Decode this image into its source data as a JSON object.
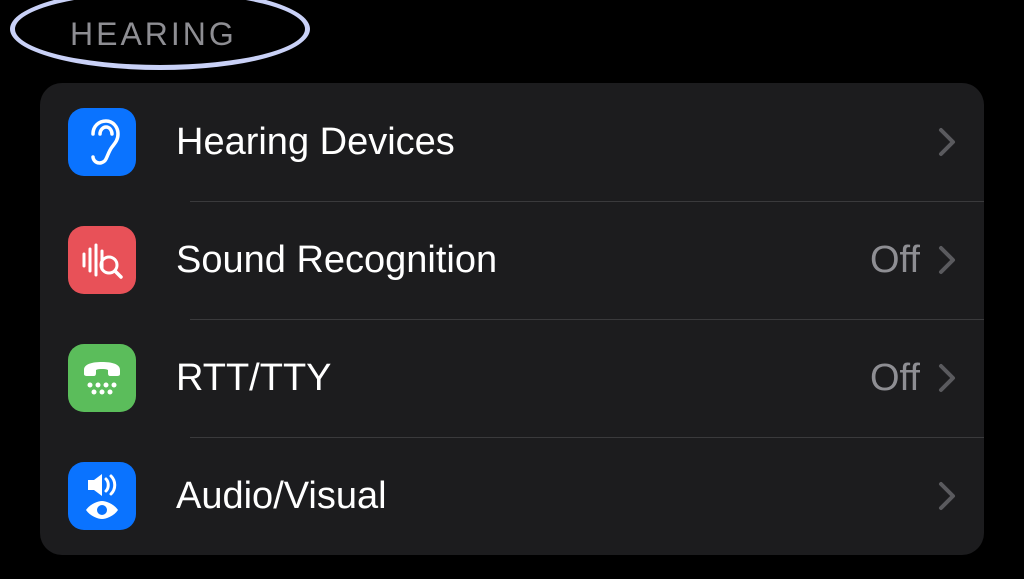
{
  "section": {
    "header": "HEARING",
    "rows": [
      {
        "key": "hearing-devices",
        "label": "Hearing Devices",
        "value": null,
        "icon": "ear-icon",
        "icon_bg": "blue"
      },
      {
        "key": "sound-recognition",
        "label": "Sound Recognition",
        "value": "Off",
        "icon": "sound-search-icon",
        "icon_bg": "red"
      },
      {
        "key": "rtt-tty",
        "label": "RTT/TTY",
        "value": "Off",
        "icon": "tty-icon",
        "icon_bg": "green"
      },
      {
        "key": "audio-visual",
        "label": "Audio/Visual",
        "value": null,
        "icon": "speaker-eye-icon",
        "icon_bg": "blue"
      }
    ]
  }
}
